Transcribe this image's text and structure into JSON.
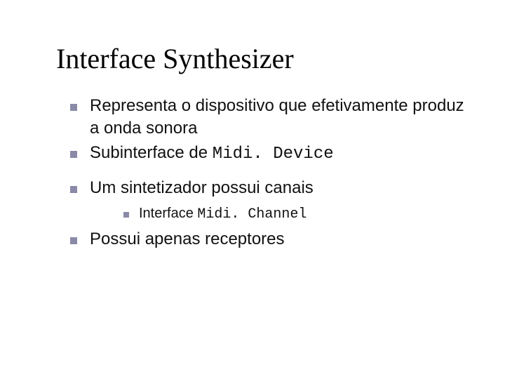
{
  "title": "Interface Synthesizer",
  "bullets": {
    "b1": "Representa o dispositivo que efetivamente produz a onda sonora",
    "b2_pre": "Subinterface de ",
    "b2_code": "Midi. Device",
    "b3": "Um sintetizador possui canais",
    "b3_sub_pre": "Interface ",
    "b3_sub_code": "Midi. Channel",
    "b4": "Possui apenas receptores"
  }
}
